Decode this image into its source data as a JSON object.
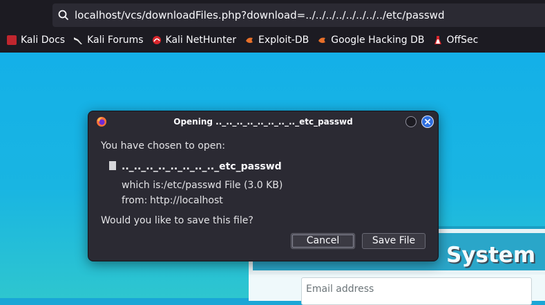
{
  "browser": {
    "url": "localhost/vcs/downloadFiles.php?download=../../../../../../../../etc/passwd",
    "bookmarks": [
      {
        "label": "Kali Docs",
        "icon": "kali-docs-icon"
      },
      {
        "label": "Kali Forums",
        "icon": "kali-dragon-icon"
      },
      {
        "label": "Kali NetHunter",
        "icon": "nethunter-icon"
      },
      {
        "label": "Exploit-DB",
        "icon": "exploit-db-icon"
      },
      {
        "label": "Google Hacking DB",
        "icon": "ghdb-icon"
      },
      {
        "label": "OffSec",
        "icon": "offsec-icon"
      }
    ]
  },
  "page": {
    "card_title": "System",
    "email_placeholder": "Email address"
  },
  "dialog": {
    "title": "Opening .._.._.._.._.._.._.._.._etc_passwd",
    "intro": "You have chosen to open:",
    "filename": ".._.._.._.._.._.._.._.._etc_passwd",
    "which_is_label": "which is:",
    "which_is_value": "/etc/passwd File (3.0 KB)",
    "from_label": "from:",
    "from_value": "http://localhost",
    "question": "Would you like to save this file?",
    "cancel_label": "Cancel",
    "save_label": "Save File"
  },
  "colors": {
    "accent_close": "#2f6fe0",
    "page_bg": "#19b5e2",
    "dialog_bg": "#2b2a33"
  }
}
